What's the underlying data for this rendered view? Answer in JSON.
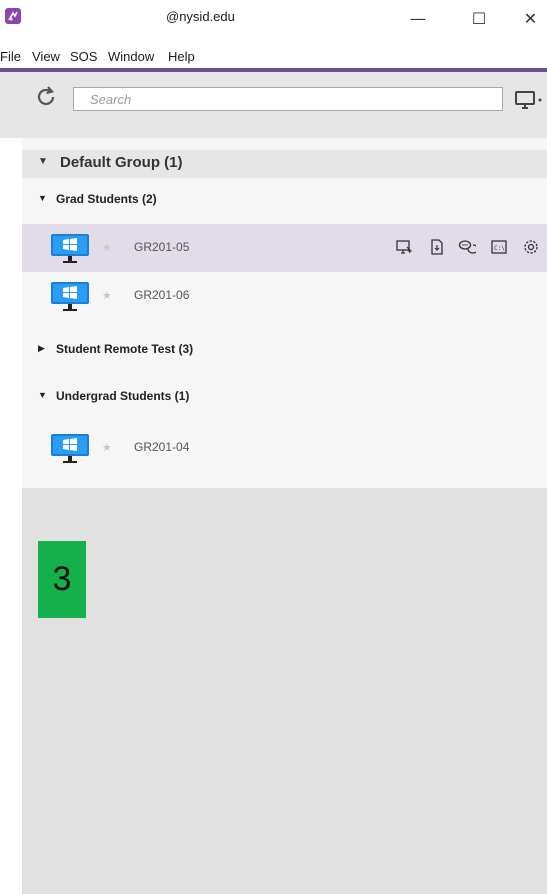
{
  "window": {
    "title": "@nysid.edu",
    "min_label": "—",
    "max_label": "☐",
    "close_label": "✕"
  },
  "menu": [
    "File",
    "View",
    "SOS",
    "Window",
    "Help"
  ],
  "toolbar": {
    "search_placeholder": "Search"
  },
  "tree": {
    "group": {
      "label": "Default Group (1)",
      "expanded": true
    },
    "subgroups": [
      {
        "label": "Grad Students (2)",
        "expanded": true,
        "devices": [
          {
            "name": "GR201-05",
            "selected": true
          },
          {
            "name": "GR201-06",
            "selected": false
          }
        ]
      },
      {
        "label": "Student Remote Test (3)",
        "expanded": false,
        "devices": []
      },
      {
        "label": "Undergrad Students (1)",
        "expanded": true,
        "devices": [
          {
            "name": "GR201-04",
            "selected": false
          }
        ]
      }
    ]
  },
  "device_actions": [
    "remote-control-icon",
    "file-transfer-icon",
    "chat-icon",
    "command-prompt-icon",
    "settings-icon"
  ],
  "step_badge": "3",
  "colors": {
    "accent": "#6a4f8f",
    "selected_row": "#e2dbe8",
    "badge": "#13b04b",
    "windows_blue": "#1e90ff"
  }
}
